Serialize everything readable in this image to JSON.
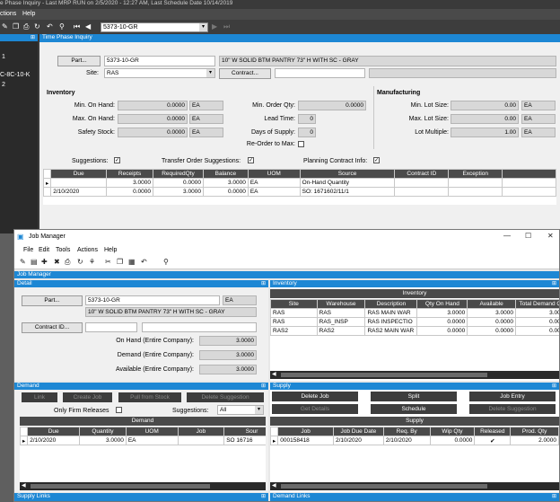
{
  "tpi": {
    "window_title": "e Phase Inquiry  -  Last MRP RUN on 2/5/2020 - 12:27 AM, Last Schedule Date  10/14/2019",
    "menu": [
      "ctions",
      "Help"
    ],
    "part_combo": "5373-10-GR",
    "tree_items": [
      "1",
      "C-8C-10-K",
      "2"
    ],
    "panel_title": "Time Phase Inquiry",
    "part_button": "Part...",
    "part_value": "5373-10-GR",
    "part_description": "10\" W SOLID BTM PANTRY 73\" H WITH SC - GRAY",
    "site_label": "Site:",
    "site_value": "RAS",
    "contract_button": "Contract...",
    "inventory_title": "Inventory",
    "min_on_hand_label": "Min. On Hand:",
    "min_on_hand": "0.0000",
    "max_on_hand_label": "Max. On Hand:",
    "max_on_hand": "0.0000",
    "safety_stock_label": "Safety Stock:",
    "safety_stock": "0.0000",
    "uom": "EA",
    "min_order_qty_label": "Min. Order Qty:",
    "min_order_qty": "0.0000",
    "lead_time_label": "Lead Time:",
    "lead_time": "0",
    "days_supply_label": "Days of Supply:",
    "days_supply": "0",
    "reorder_label": "Re-Order to Max:",
    "manufacturing_title": "Manufacturing",
    "min_lot_label": "Min. Lot Size:",
    "min_lot": "0.00",
    "max_lot_label": "Max. Lot Size:",
    "max_lot": "0.00",
    "lot_multiple_label": "Lot Multiple:",
    "lot_multiple": "1.00",
    "suggestions_label": "Suggestions:",
    "transfer_label": "Transfer Order Suggestions:",
    "planning_label": "Planning Contract Info:",
    "grid_headers": [
      "Due",
      "Receipts",
      "RequiredQty",
      "Balance",
      "UOM",
      "Source",
      "Contract ID",
      "Exception"
    ],
    "grid_rows": [
      [
        "",
        "3.0000",
        "0.0000",
        "3.0000",
        "EA",
        "On-Hand Quantity",
        "",
        ""
      ],
      [
        "2/10/2020",
        "0.0000",
        "3.0000",
        "0.0000",
        "EA",
        "SO: 1671602/11/1",
        "",
        ""
      ]
    ]
  },
  "jm": {
    "window_title": "Job Manager",
    "menu": [
      "File",
      "Edit",
      "Tools",
      "Actions",
      "Help"
    ],
    "tab_title": "Job Manager",
    "detail_title": "Detail",
    "part_button": "Part...",
    "part_value": "5373-10-GR",
    "uom": "EA",
    "part_description": "10\" W SOLID BTM PANTRY 73\" H WITH SC - GRAY",
    "contract_button": "Contract ID...",
    "on_hand_label": "On Hand (Entire Company):",
    "on_hand": "3.0000",
    "demand_label": "Demand (Entire Company):",
    "demand": "3.0000",
    "available_label": "Available (Entire Company):",
    "available": "3.0000",
    "inventory_title": "Inventory",
    "inv_caption": "Inventory",
    "inv_headers": [
      "Site",
      "Warehouse",
      "Description",
      "Qty On Hand",
      "Available",
      "Total Demand Qty"
    ],
    "inv_rows": [
      [
        "RAS",
        "RAS",
        "RAS MAIN WAR",
        "3.0000",
        "3.0000",
        "3.0000"
      ],
      [
        "RAS",
        "RAS_INSP",
        "RAS INSPECTIO",
        "0.0000",
        "0.0000",
        "0.0000"
      ],
      [
        "RAS2",
        "RAS2",
        "RAS2 MAIN WAR",
        "0.0000",
        "0.0000",
        "0.0000"
      ]
    ],
    "demand_title": "Demand",
    "demand_buttons": [
      "Link",
      "Create Job",
      "Pull from Stock",
      "Delete Suggestion"
    ],
    "firm_label": "Only Firm Releases",
    "suggestions_label": "Suggestions:",
    "suggestions_value": "All",
    "dem_caption": "Demand",
    "dem_headers": [
      "Due",
      "Quantity",
      "UOM",
      "Job",
      "Sour"
    ],
    "dem_rows": [
      [
        "2/10/2020",
        "3.0000",
        "EA",
        "",
        "SO 16716"
      ]
    ],
    "supply_title": "Supply",
    "supply_buttons": [
      "Delete Job",
      "Split",
      "Job Entry",
      "Get Details",
      "Schedule",
      "Delete Suggestion"
    ],
    "sup_caption": "Supply",
    "sup_headers": [
      "Job",
      "Job Due Date",
      "Req. By",
      "Wip Qty",
      "Released",
      "Prod. Qty"
    ],
    "sup_rows": [
      [
        "000158418",
        "2/10/2020",
        "2/10/2020",
        "0.0000",
        "✔",
        "2.0000"
      ]
    ],
    "supply_links": "Supply Links",
    "demand_links": "Demand Links"
  }
}
